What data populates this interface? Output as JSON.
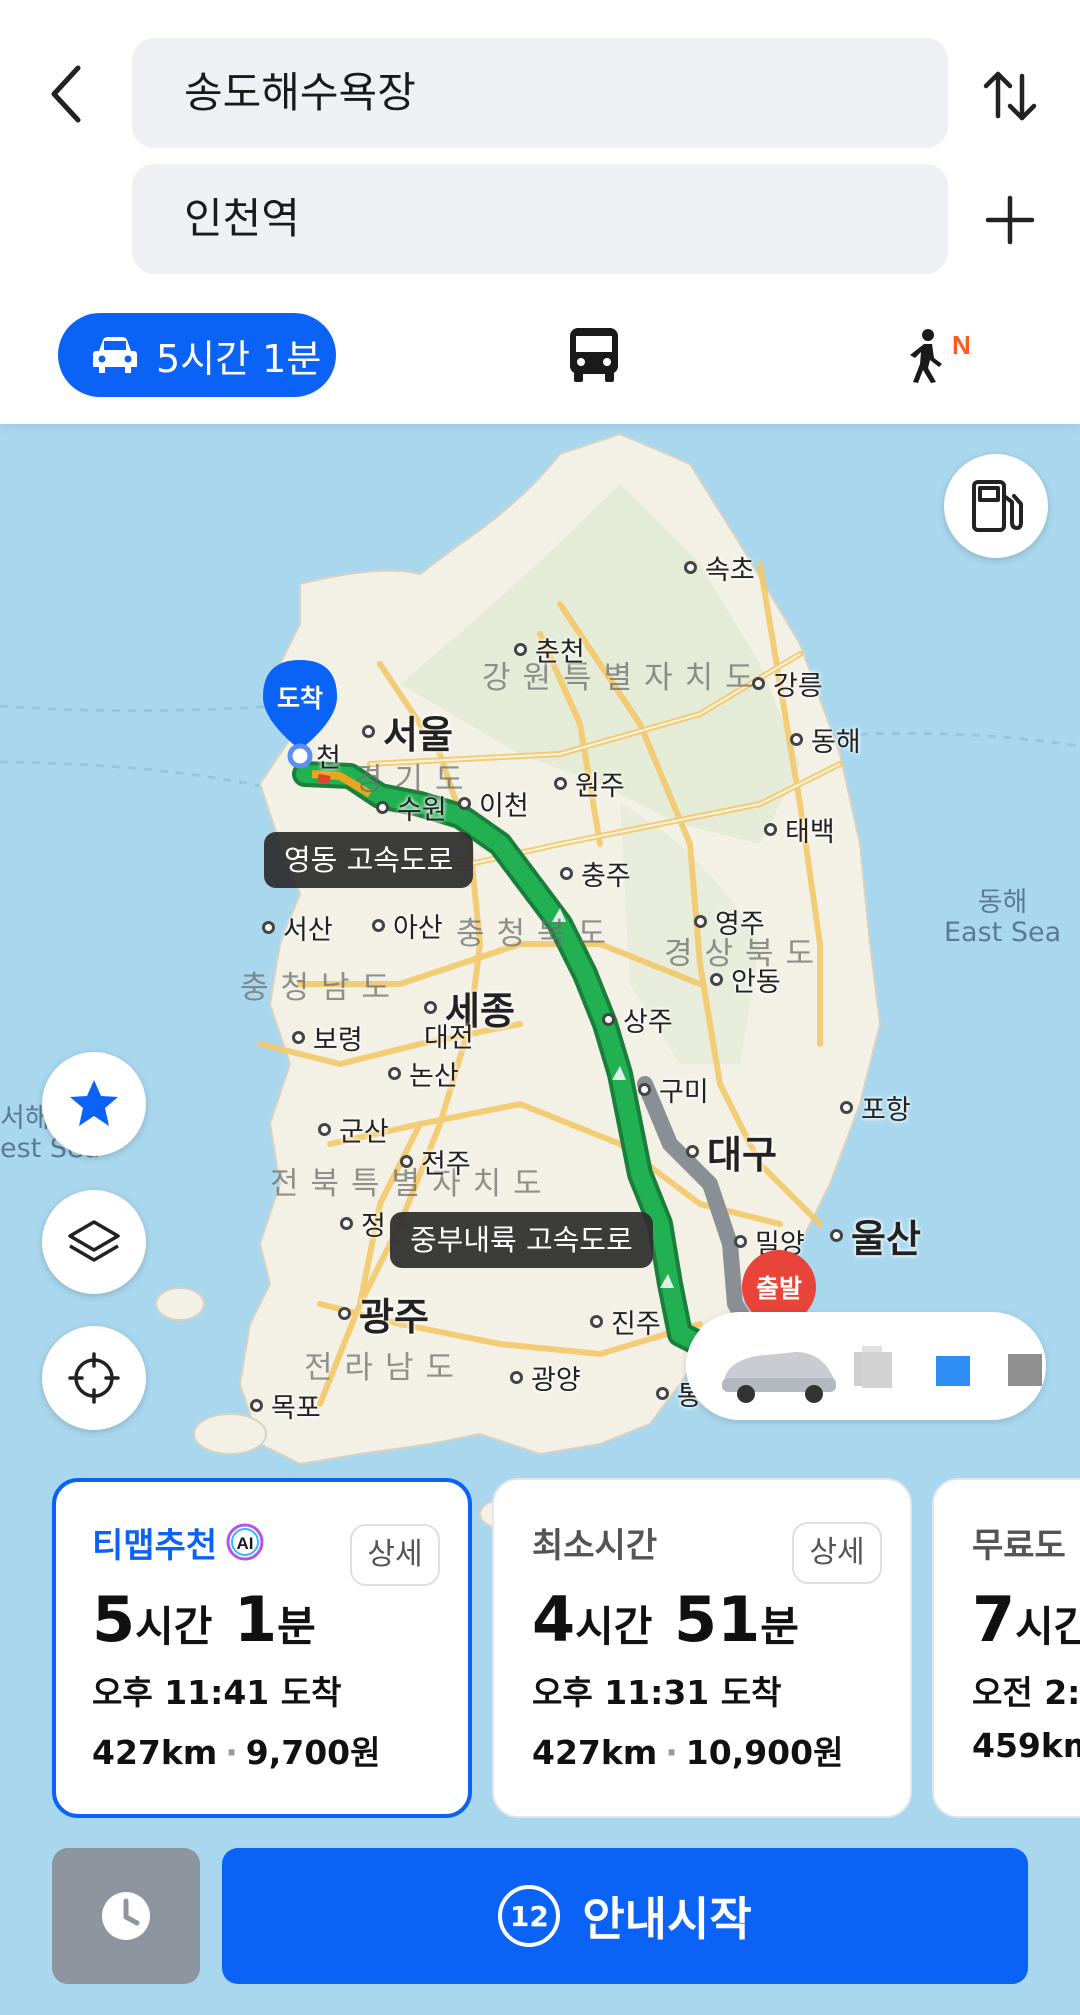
{
  "search": {
    "origin": "송도해수욕장",
    "destination": "인천역"
  },
  "icons": {
    "back": "chevron-left-icon",
    "swap": "swap-vertical-icon",
    "add": "plus-icon",
    "car": "car-icon",
    "bus": "bus-icon",
    "walk": "walk-icon",
    "gas": "gas-station-icon",
    "favorite": "star-icon",
    "layers": "layers-icon",
    "location": "crosshair-icon",
    "clock": "clock-icon"
  },
  "modes": {
    "car_label": "5시간 1분",
    "walk_badge": "N"
  },
  "map": {
    "cities": {
      "sokcho": "속초",
      "chuncheon": "춘천",
      "gangneung": "강릉",
      "seoul": "서울",
      "donghae": "동해",
      "incheon": "천",
      "wonju": "원주",
      "suwon": "수원",
      "icheon": "이천",
      "taebaek": "태백",
      "chungju": "충주",
      "seosan": "서산",
      "asan": "아산",
      "yeongju": "영주",
      "andong": "안동",
      "sejong": "세종",
      "daejeon": "대전",
      "sangju": "상주",
      "boryeong": "보령",
      "nonsan": "논산",
      "gumi": "구미",
      "pohang": "포항",
      "daegu": "대구",
      "gunsan": "군산",
      "jeonju": "전주",
      "jeong": "정",
      "miryang": "밀양",
      "ulsan": "울산",
      "gwangju": "광주",
      "jinju": "진주",
      "gwangyang": "광양",
      "mokpo": "목포",
      "tong": "통"
    },
    "regions": {
      "gangwon": "강원특별자치도",
      "gyeonggi": "경기도",
      "chungbuk": "충청북도",
      "gyeongbuk": "경상북도",
      "chungnam": "충청남도",
      "jeonbuk": "전북특별자치도",
      "jeonnam": "전라남도"
    },
    "sea": {
      "east_ko": "동해",
      "east_en": "East Sea",
      "west_ko": "서해",
      "west_en": "est Sea"
    },
    "road_labels": {
      "yeongdong": "영동 고속도로",
      "jungbu": "중부내륙 고속도로"
    },
    "pins": {
      "arrival": "도착",
      "departure": "출발"
    }
  },
  "routes": [
    {
      "title": "티맵추천",
      "ai_badge": "AI",
      "detail": "상세",
      "hours": "5",
      "hours_unit": "시간",
      "minutes": "1",
      "minutes_unit": "분",
      "arrive": "오후 11:41 도착",
      "distance": "427km",
      "fare": "9,700원"
    },
    {
      "title": "최소시간",
      "detail": "상세",
      "hours": "4",
      "hours_unit": "시간",
      "minutes": "51",
      "minutes_unit": "분",
      "arrive": "오후 11:31 도착",
      "distance": "427km",
      "fare": "10,900원"
    },
    {
      "title": "무료도",
      "hours": "7",
      "hours_unit": "시간",
      "arrive": "오전 2:",
      "distance": "459km"
    }
  ],
  "bottom": {
    "start_label": "안내시작",
    "countdown": "12"
  },
  "colors": {
    "primary": "#0a63f6",
    "route_green": "#1fa94c",
    "alt_route": "#8a8f96",
    "sea": "#a9d8ee",
    "land": "#f3f1e6"
  }
}
